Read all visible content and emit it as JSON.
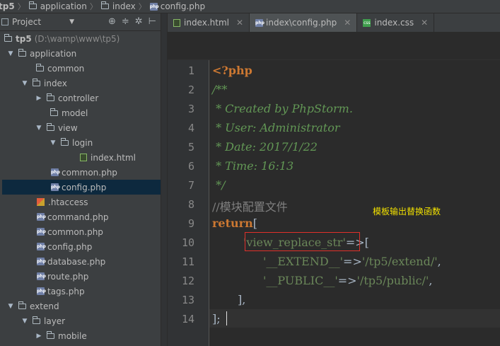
{
  "breadcrumb": [
    "tp5",
    "application",
    "index",
    "config.php"
  ],
  "sidebar": {
    "title": "Project",
    "items": [
      {
        "label": "tp5",
        "path": "(D:\\wamp\\www\\tp5)"
      },
      {
        "label": "application"
      },
      {
        "label": "common"
      },
      {
        "label": "index"
      },
      {
        "label": "controller"
      },
      {
        "label": "model"
      },
      {
        "label": "view"
      },
      {
        "label": "login"
      },
      {
        "label": "index.html"
      },
      {
        "label": "common.php"
      },
      {
        "label": "config.php"
      },
      {
        "label": ".htaccess"
      },
      {
        "label": "command.php"
      },
      {
        "label": "common.php"
      },
      {
        "label": "config.php"
      },
      {
        "label": "database.php"
      },
      {
        "label": "route.php"
      },
      {
        "label": "tags.php"
      },
      {
        "label": "extend"
      },
      {
        "label": "layer"
      },
      {
        "label": "mobile"
      }
    ]
  },
  "tabs": [
    {
      "label": "index.html"
    },
    {
      "label": "index\\config.php"
    },
    {
      "label": "index.css"
    }
  ],
  "editor": {
    "line_numbers": [
      "1",
      "2",
      "3",
      "4",
      "5",
      "6",
      "7",
      "8",
      "9",
      "10",
      "11",
      "12",
      "13",
      "14"
    ],
    "lines": {
      "l1": "<?php",
      "l2": "/**",
      "l3": " * Created by PhpStorm.",
      "l4": " * User: Administrator",
      "l5": " * Date: 2017/1/22",
      "l6": " * Time: 16:13",
      "l7": " */",
      "l8": "//模块配置文件",
      "l9_kw": "return",
      "l9_rest": "[",
      "l10_str": "'view_replace_str'",
      "l10_rest": "=>[",
      "l11_key": "'__EXTEND__'",
      "l11_op": "=>",
      "l11_val": "'/tp5/extend/'",
      "l11_end": ",",
      "l12_key": "'__PUBLIC__'",
      "l12_op": "=>",
      "l12_val": "'/tp5/public/'",
      "l12_end": ",",
      "l13": "],",
      "l14": "];"
    }
  },
  "annotation": "模板输出替换函数",
  "colors": {
    "highlight_box": "#e0302a",
    "annotation": "#f2e100",
    "selected_row": "#0d293e"
  }
}
